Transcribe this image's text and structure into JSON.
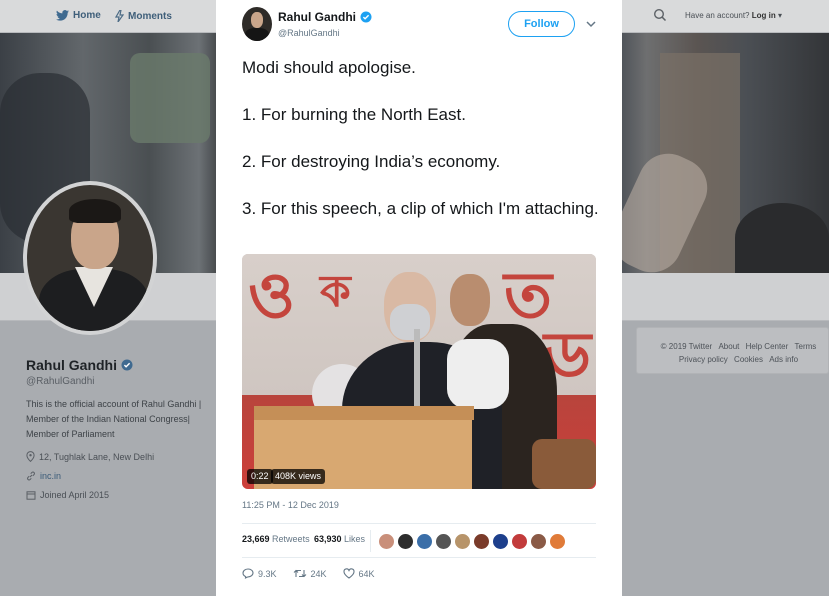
{
  "nav": {
    "home_label": "Home",
    "moments_label": "Moments",
    "login_prefix": "Have an account?",
    "login_label": "Log in"
  },
  "profile": {
    "name": "Rahul Gandhi",
    "handle": "@RahulGandhi",
    "bio": "This is the official account of Rahul Gandhi | Member of the Indian National Congress| Member of Parliament",
    "location": "12, Tughlak Lane, New Delhi",
    "website": "inc.in",
    "joined": "Joined April 2015"
  },
  "footer": {
    "links": [
      "© 2019 Twitter",
      "About",
      "Help Center",
      "Terms",
      "Privacy policy",
      "Cookies",
      "Ads info"
    ]
  },
  "tweet": {
    "author_name": "Rahul Gandhi",
    "author_handle": "@RahulGandhi",
    "follow_label": "Follow",
    "lines": [
      "Modi should apologise.",
      "1. For burning the North East.",
      "2. For destroying India’s economy.",
      "3. For this speech, a clip of which I'm attaching."
    ],
    "video": {
      "duration": "0:22",
      "views": "408K views"
    },
    "timestamp": "11:25 PM - 12 Dec 2019",
    "retweets_count": "23,669",
    "retweets_label": "Retweets",
    "likes_count": "63,930",
    "likes_label": "Likes",
    "liker_colors": [
      "#c98f7a",
      "#2d2d2d",
      "#3a6ea8",
      "#555555",
      "#b7946a",
      "#7a3b2a",
      "#1d3f8c",
      "#c23b3b",
      "#8a5a46",
      "#e07b39"
    ],
    "replies": "9.3K",
    "retweets_short": "24K",
    "likes_short": "64K"
  },
  "colors": {
    "accent": "#1da1f2",
    "verified": "#1da1f2"
  }
}
